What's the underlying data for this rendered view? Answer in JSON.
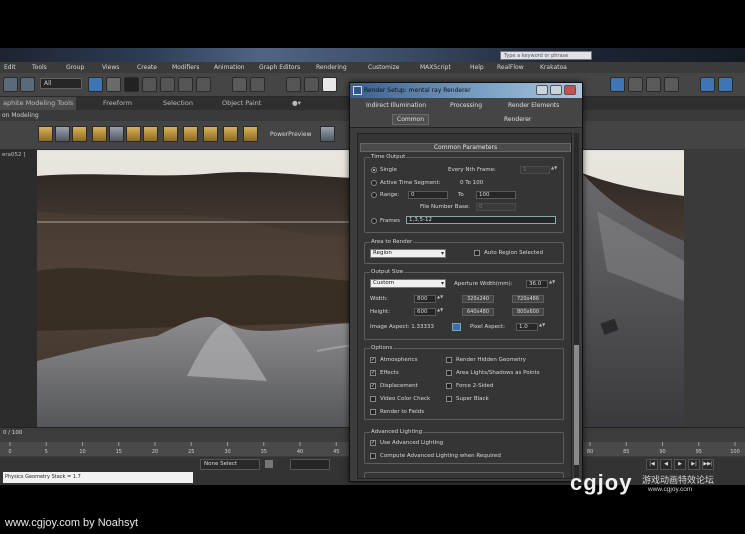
{
  "titlebar": {
    "search_placeholder": "Type a keyword or phrase"
  },
  "menu": {
    "items": [
      "Edit",
      "Tools",
      "Group",
      "Views",
      "Create",
      "Modifiers",
      "Animation",
      "Graph Editors",
      "Rendering",
      "Customize",
      "MAXScript",
      "Help",
      "RealFlow",
      "Krakatoa"
    ]
  },
  "toolbar": {
    "selection_filter": "All"
  },
  "ribbon": {
    "tabs": [
      "aphite Modeling Tools",
      "Freeform",
      "Selection",
      "Object Paint"
    ],
    "sub_label": "on Modeling",
    "power_preview": "PowerPreview"
  },
  "viewport": {
    "label": "era052 ]"
  },
  "timeline": {
    "frame_counter": "0 / 100",
    "ticks": [
      "0",
      "5",
      "10",
      "15",
      "20",
      "25",
      "30",
      "35",
      "40",
      "45",
      "50",
      "55",
      "60",
      "65",
      "70",
      "75",
      "80",
      "85",
      "90",
      "95",
      "100"
    ]
  },
  "status": {
    "maxscript_text": "Physics Geometry Stack = 1.7",
    "selection_status": "None Select",
    "playback_buttons": [
      "|◀",
      "◀",
      "▶",
      "▶|",
      "▶▶|"
    ]
  },
  "dialog": {
    "title": "Render Setup: mental ray Renderer",
    "tabs_row1": [
      "Indirect Illumination",
      "Processing",
      "Render Elements"
    ],
    "tabs_row2": [
      "Common",
      "Renderer"
    ],
    "rollout": "Common Parameters",
    "time_output": {
      "title": "Time Output",
      "single": "Single",
      "every_nth": "Every Nth Frame:",
      "nth_value": "1",
      "active_segment": "Active Time Segment:",
      "active_range": "0 To 100",
      "range": "Range:",
      "range_from": "0",
      "range_to_label": "To",
      "range_to": "100",
      "file_number_base": "File Number Base:",
      "file_number_value": "0",
      "frames": "Frames",
      "frames_value": "1,3,5-12"
    },
    "area": {
      "title": "Area to Render",
      "value": "Region",
      "auto_region": "Auto Region Selected"
    },
    "output_size": {
      "title": "Output Size",
      "preset": "Custom",
      "aperture_label": "Aperture Width(mm):",
      "aperture_value": "36.0",
      "width_label": "Width:",
      "width_value": "800",
      "height_label": "Height:",
      "height_value": "600",
      "presets": [
        "320x240",
        "720x486",
        "640x480",
        "800x600"
      ],
      "image_aspect_label": "Image Aspect: 1.33333",
      "pixel_aspect_label": "Pixel Aspect:",
      "pixel_aspect_value": "1.0"
    },
    "options": {
      "title": "Options",
      "left": [
        {
          "label": "Atmospherics",
          "checked": true
        },
        {
          "label": "Effects",
          "checked": true
        },
        {
          "label": "Displacement",
          "checked": true
        },
        {
          "label": "Video Color Check",
          "checked": false
        },
        {
          "label": "Render to Fields",
          "checked": false
        }
      ],
      "right": [
        {
          "label": "Render Hidden Geometry",
          "checked": false
        },
        {
          "label": "Area Lights/Shadows as Points",
          "checked": false
        },
        {
          "label": "Force 2-Sided",
          "checked": false
        },
        {
          "label": "Super Black",
          "checked": false
        }
      ]
    },
    "advanced_lighting": {
      "title": "Advanced Lighting",
      "use": "Use Advanced Lighting",
      "use_checked": true,
      "compute": "Compute Advanced Lighting when Required",
      "compute_checked": false
    }
  },
  "watermark": {
    "credit": "www.cgjoy.com by Noahsyt",
    "logo": "cgjoy",
    "chinese": "游戏动画特效论坛",
    "url": "www.cgjoy.com"
  }
}
